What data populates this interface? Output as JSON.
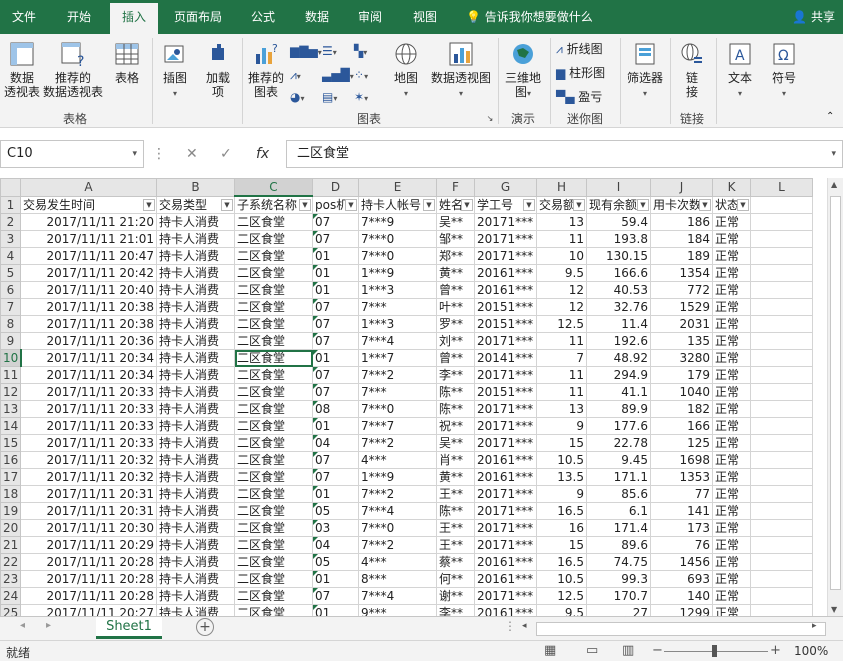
{
  "ribbon_tabs": [
    "文件",
    "开始",
    "插入",
    "页面布局",
    "公式",
    "数据",
    "审阅",
    "视图"
  ],
  "active_tab": "插入",
  "tell_me": "告诉我你想要做什么",
  "share": "共享",
  "ribbon": {
    "pivot_table": "数据\n透视表",
    "recommended_pivot": "推荐的\n数据透视表",
    "table": "表格",
    "group_tables": "表格",
    "illustrations": "插图",
    "addins": "加载\n项",
    "recommended_charts": "推荐的\n图表",
    "map": "地图",
    "pivot_chart": "数据透视图",
    "group_charts": "图表",
    "map_3d": "三维地\n图",
    "group_tours": "演示",
    "spark_line": "折线图",
    "spark_column": "柱形图",
    "spark_winloss": "盈亏",
    "group_sparklines": "迷你图",
    "filter": "筛选器",
    "link": "链\n接",
    "group_links": "链接",
    "text": "文本",
    "symbol": "符号"
  },
  "name_box": "C10",
  "formula_value": "二区食堂",
  "columns": [
    "A",
    "B",
    "C",
    "D",
    "E",
    "F",
    "G",
    "H",
    "I",
    "J",
    "K",
    "L"
  ],
  "selected_column": "C",
  "headers": [
    "交易发生时间",
    "交易类型",
    "子系统名称",
    "pos机",
    "持卡人帐号",
    "姓名",
    "学工号",
    "交易额",
    "现有余额",
    "用卡次数",
    "状态"
  ],
  "rows": [
    [
      "2017/11/11 21:20",
      "持卡人消费",
      "二区食堂",
      "07",
      "7***9",
      "吴**",
      "20171***",
      "13",
      "59.4",
      "186",
      "正常"
    ],
    [
      "2017/11/11 21:01",
      "持卡人消费",
      "二区食堂",
      "07",
      "7***0",
      "邹**",
      "20171***",
      "11",
      "193.8",
      "184",
      "正常"
    ],
    [
      "2017/11/11 20:47",
      "持卡人消费",
      "二区食堂",
      "01",
      "7***0",
      "郑**",
      "20171***",
      "10",
      "130.15",
      "189",
      "正常"
    ],
    [
      "2017/11/11 20:42",
      "持卡人消费",
      "二区食堂",
      "01",
      "1***9",
      "黄**",
      "20161***",
      "9.5",
      "166.6",
      "1354",
      "正常"
    ],
    [
      "2017/11/11 20:40",
      "持卡人消费",
      "二区食堂",
      "01",
      "1***3",
      "曾**",
      "20161***",
      "12",
      "40.53",
      "772",
      "正常"
    ],
    [
      "2017/11/11 20:38",
      "持卡人消费",
      "二区食堂",
      "07",
      "7***",
      "叶**",
      "20151***",
      "12",
      "32.76",
      "1529",
      "正常"
    ],
    [
      "2017/11/11 20:38",
      "持卡人消费",
      "二区食堂",
      "07",
      "1***3",
      "罗**",
      "20151***",
      "12.5",
      "11.4",
      "2031",
      "正常"
    ],
    [
      "2017/11/11 20:36",
      "持卡人消费",
      "二区食堂",
      "07",
      "7***4",
      "刘**",
      "20171***",
      "11",
      "192.6",
      "135",
      "正常"
    ],
    [
      "2017/11/11 20:34",
      "持卡人消费",
      "二区食堂",
      "01",
      "1***7",
      "曾**",
      "20141***",
      "7",
      "48.92",
      "3280",
      "正常"
    ],
    [
      "2017/11/11 20:34",
      "持卡人消费",
      "二区食堂",
      "07",
      "7***2",
      "李**",
      "20171***",
      "11",
      "294.9",
      "179",
      "正常"
    ],
    [
      "2017/11/11 20:33",
      "持卡人消费",
      "二区食堂",
      "07",
      "7***",
      "陈**",
      "20151***",
      "11",
      "41.1",
      "1040",
      "正常"
    ],
    [
      "2017/11/11 20:33",
      "持卡人消费",
      "二区食堂",
      "08",
      "7***0",
      "陈**",
      "20171***",
      "13",
      "89.9",
      "182",
      "正常"
    ],
    [
      "2017/11/11 20:33",
      "持卡人消费",
      "二区食堂",
      "01",
      "7***7",
      "祝**",
      "20171***",
      "9",
      "177.6",
      "166",
      "正常"
    ],
    [
      "2017/11/11 20:33",
      "持卡人消费",
      "二区食堂",
      "04",
      "7***2",
      "吴**",
      "20171***",
      "15",
      "22.78",
      "125",
      "正常"
    ],
    [
      "2017/11/11 20:32",
      "持卡人消费",
      "二区食堂",
      "07",
      "4***",
      "肖**",
      "20161***",
      "10.5",
      "9.45",
      "1698",
      "正常"
    ],
    [
      "2017/11/11 20:32",
      "持卡人消费",
      "二区食堂",
      "07",
      "1***9",
      "黄**",
      "20161***",
      "13.5",
      "171.1",
      "1353",
      "正常"
    ],
    [
      "2017/11/11 20:31",
      "持卡人消费",
      "二区食堂",
      "01",
      "7***2",
      "王**",
      "20171***",
      "9",
      "85.6",
      "77",
      "正常"
    ],
    [
      "2017/11/11 20:31",
      "持卡人消费",
      "二区食堂",
      "05",
      "7***4",
      "陈**",
      "20171***",
      "16.5",
      "6.1",
      "141",
      "正常"
    ],
    [
      "2017/11/11 20:30",
      "持卡人消费",
      "二区食堂",
      "03",
      "7***0",
      "王**",
      "20171***",
      "16",
      "171.4",
      "173",
      "正常"
    ],
    [
      "2017/11/11 20:29",
      "持卡人消费",
      "二区食堂",
      "04",
      "7***2",
      "王**",
      "20171***",
      "15",
      "89.6",
      "76",
      "正常"
    ],
    [
      "2017/11/11 20:28",
      "持卡人消费",
      "二区食堂",
      "05",
      "4***",
      "蔡**",
      "20161***",
      "16.5",
      "74.75",
      "1456",
      "正常"
    ],
    [
      "2017/11/11 20:28",
      "持卡人消费",
      "二区食堂",
      "01",
      "8***",
      "何**",
      "20161***",
      "10.5",
      "99.3",
      "693",
      "正常"
    ],
    [
      "2017/11/11 20:28",
      "持卡人消费",
      "二区食堂",
      "07",
      "7***4",
      "谢**",
      "20171***",
      "12.5",
      "170.7",
      "140",
      "正常"
    ],
    [
      "2017/11/11 20:27",
      "持卡人消费",
      "二区食堂",
      "01",
      "9***",
      "李**",
      "20161***",
      "9.5",
      "27",
      "1299",
      "正常"
    ]
  ],
  "sheet_name": "Sheet1",
  "status_left": "就绪",
  "zoom": "100%"
}
